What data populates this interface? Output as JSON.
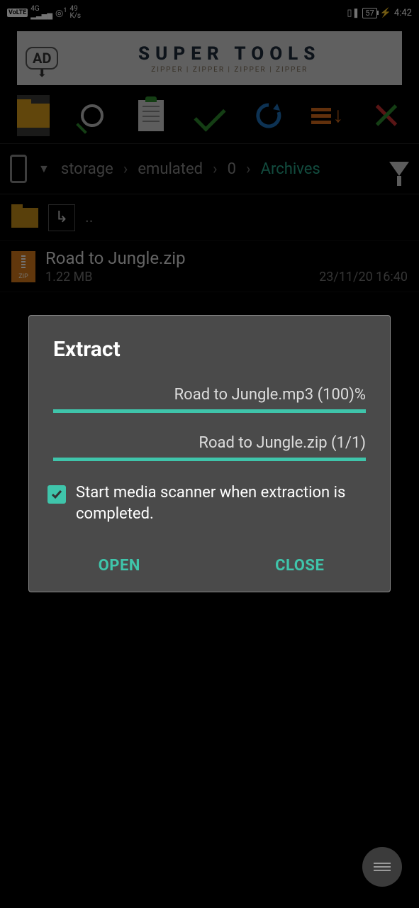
{
  "status": {
    "volte": "VoLTE",
    "sig_label": "4G",
    "net_speed_num": "49",
    "net_speed_unit": "K/s",
    "hotspot_badge": "1",
    "vibrate_icon": "vibrate",
    "battery": "57",
    "charging": "⚡",
    "time": "4:42"
  },
  "ad": {
    "badge": "AD",
    "title": "SUPER TOOLS",
    "sub": "ZIPPER | ZIPPER | ZIPPER | ZIPPER"
  },
  "breadcrumb": {
    "items": [
      "storage",
      "emulated",
      "0",
      "Archives"
    ]
  },
  "parent_dots": "..",
  "file": {
    "name": "Road to Jungle.zip",
    "size": "1.22 MB",
    "date": "23/11/20 16:40",
    "badge": "ZIP"
  },
  "dialog": {
    "title": "Extract",
    "progress1_label": "Road to Jungle.mp3 (100)%",
    "progress2_label": "Road to Jungle.zip (1/1)",
    "checkbox_label": "Start media scanner when extraction is completed.",
    "open": "OPEN",
    "close": "CLOSE"
  }
}
